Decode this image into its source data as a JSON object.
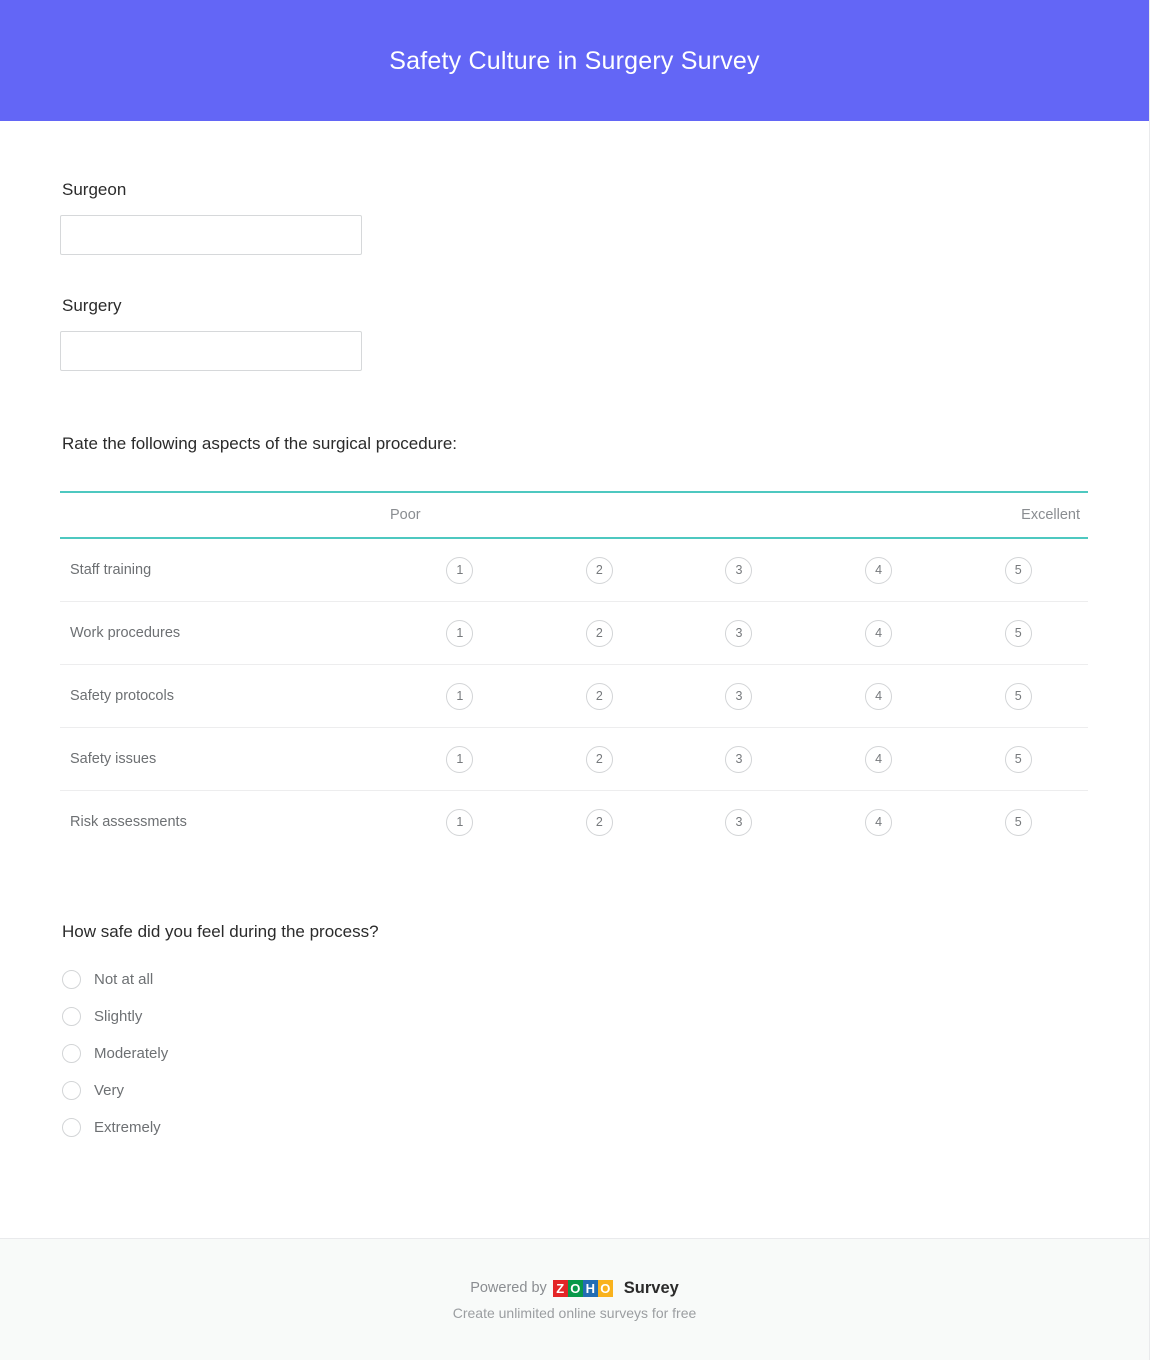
{
  "header": {
    "title": "Safety Culture in Surgery Survey",
    "background_color": "#6366F6",
    "text_color": "#FFFFFF"
  },
  "questions": {
    "surgeon": {
      "label": "Surgeon",
      "value": "",
      "placeholder": ""
    },
    "surgery": {
      "label": "Surgery",
      "value": "",
      "placeholder": ""
    },
    "matrix": {
      "label": "Rate the following aspects of the surgical procedure:",
      "scale_low_label": "Poor",
      "scale_high_label": "Excellent",
      "scale_values": [
        "1",
        "2",
        "3",
        "4",
        "5"
      ],
      "rows": [
        {
          "label": "Staff training"
        },
        {
          "label": "Work procedures"
        },
        {
          "label": "Safety protocols"
        },
        {
          "label": "Safety issues"
        },
        {
          "label": "Risk assessments"
        }
      ],
      "rule_color": "#4EC8C0"
    },
    "safety_feeling": {
      "label": "How safe did you feel during the process?",
      "options": [
        {
          "label": "Not at all",
          "selected": false
        },
        {
          "label": "Slightly",
          "selected": false
        },
        {
          "label": "Moderately",
          "selected": false
        },
        {
          "label": "Very",
          "selected": false
        },
        {
          "label": "Extremely",
          "selected": false
        }
      ]
    }
  },
  "footer": {
    "powered_by": "Powered by",
    "brand_letters": [
      "Z",
      "O",
      "H",
      "O"
    ],
    "brand_word": "Survey",
    "tagline": "Create unlimited online surveys for free",
    "brand_colors": {
      "z": "#E42527",
      "o1": "#089949",
      "h": "#226DB4",
      "o2": "#F9B21D"
    }
  }
}
